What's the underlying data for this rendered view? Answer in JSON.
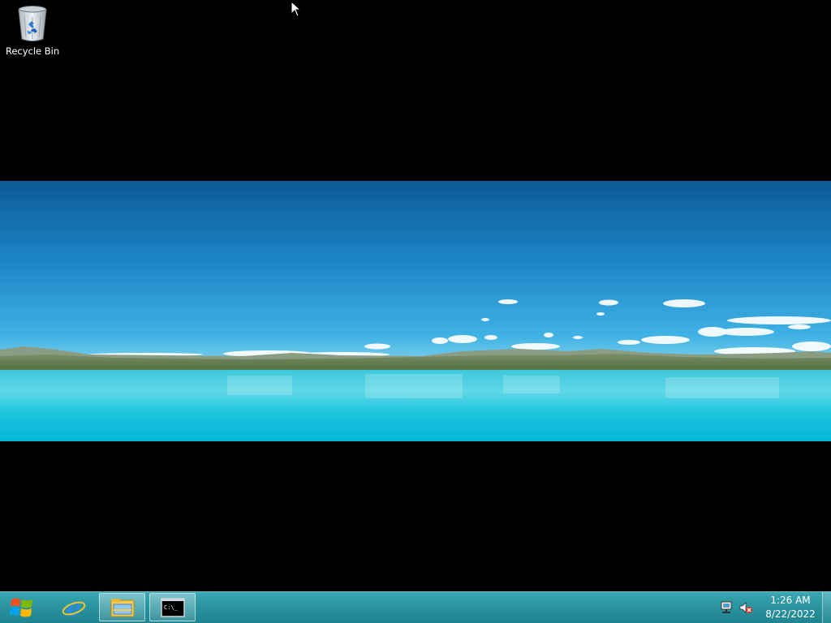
{
  "desktop": {
    "icons": [
      {
        "label": "Recycle Bin",
        "icon": "recycle-bin-icon"
      }
    ]
  },
  "taskbar": {
    "start": {
      "icon": "windows-logo-icon"
    },
    "pinned": [
      {
        "icon": "internet-explorer-icon"
      },
      {
        "icon": "file-explorer-icon"
      },
      {
        "icon": "command-prompt-icon",
        "text": "C:\\_"
      }
    ],
    "tray": {
      "icons": [
        "network-icon",
        "volume-muted-icon"
      ],
      "time": "1:26 AM",
      "date": "8/22/2022"
    }
  },
  "colors": {
    "taskbar": "#2a949f",
    "desktop_background": "#000000",
    "sky_top": "#0f5f9a",
    "water": "#1cc8dc"
  }
}
